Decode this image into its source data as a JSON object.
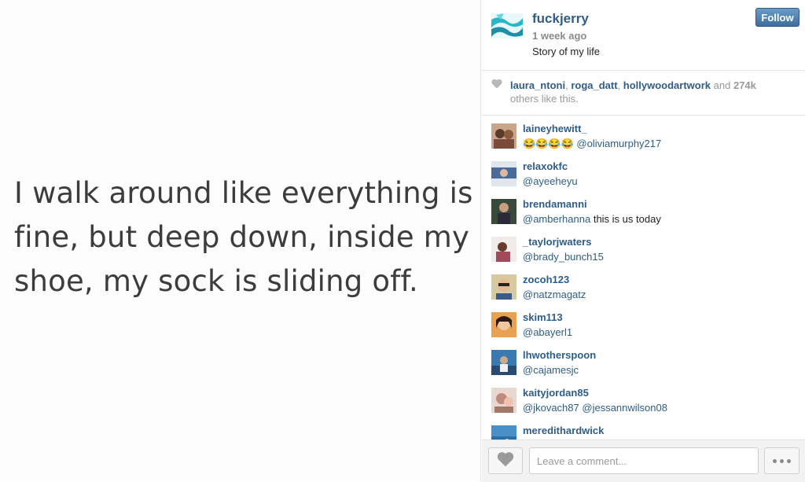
{
  "post": {
    "image_text": "I walk around like everything is\nfine, but deep down, inside my\nshoe, my sock is sliding off."
  },
  "header": {
    "username": "fuckjerry",
    "time": "1 week ago",
    "caption": "Story of my life",
    "follow_label": "Follow"
  },
  "likes": {
    "users": [
      "laura_ntoni",
      "roga_datt",
      "hollywoodartwork"
    ],
    "and_text": "and",
    "count": "274k",
    "others_text": "others like this."
  },
  "comments": [
    {
      "user": "laineyhewitt_",
      "emoji": "😂😂😂😂",
      "mention": "@oliviamurphy217",
      "text": ""
    },
    {
      "user": "relaxokfc",
      "mention": "@ayeeheyu",
      "text": ""
    },
    {
      "user": "brendamanni",
      "mention": "@amberhanna",
      "text": "this is us today"
    },
    {
      "user": "_taylorjwaters",
      "mention": "@brady_bunch15",
      "text": ""
    },
    {
      "user": "zocoh123",
      "mention": "@natzmagatz",
      "text": ""
    },
    {
      "user": "skim113",
      "mention": "@abayerl1",
      "text": ""
    },
    {
      "user": "lhwotherspoon",
      "mention": "@cajamesjc",
      "text": ""
    },
    {
      "user": "kaityjordan85",
      "mention": "@jkovach87",
      "mention2": "@jessannwilson08",
      "text": ""
    },
    {
      "user": "meredithardwick",
      "mention": "",
      "text": ""
    }
  ],
  "footer": {
    "comment_placeholder": "Leave a comment..."
  },
  "colors": {
    "username_blue": "#2f5d8a",
    "follow_button": "#3d6e9f"
  },
  "icons": [
    "heart-icon",
    "more-options-icon"
  ]
}
